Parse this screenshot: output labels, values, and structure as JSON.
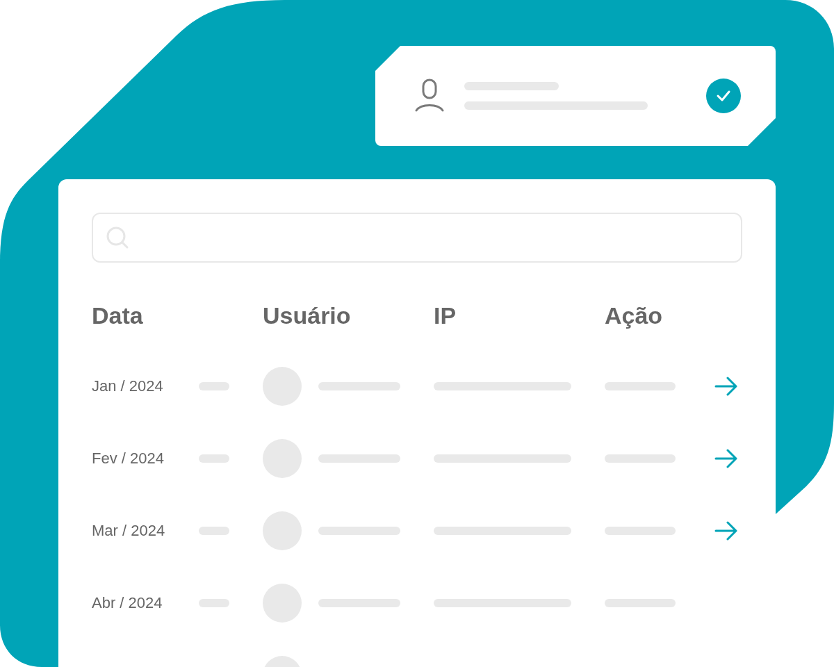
{
  "columns": [
    "Data",
    "Usuário",
    "IP",
    "Ação"
  ],
  "rows": [
    {
      "date": "Jan / 2024",
      "action": true
    },
    {
      "date": "Fev / 2024",
      "action": true
    },
    {
      "date": "Mar / 2024",
      "action": true
    },
    {
      "date": "Abr / 2024",
      "action": false
    },
    {
      "action": false
    }
  ]
}
